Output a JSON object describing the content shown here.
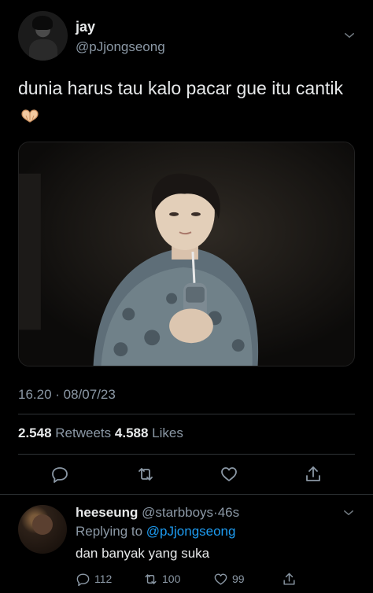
{
  "tweet": {
    "display_name": "jay",
    "handle": "@pJjongseong",
    "text": "dunia harus tau kalo pacar gue itu cantik",
    "emoji": "heart-hands-emoji",
    "timestamp": "16.20 · 08/07/23",
    "retweets_count": "2.548",
    "retweets_label": "Retweets",
    "likes_count": "4.588",
    "likes_label": "Likes"
  },
  "reply": {
    "display_name": "heeseung",
    "handle_time": "@starbboys·46s",
    "replying_prefix": "Replying to",
    "replying_to": "@pJjongseong",
    "text": "dan banyak yang suka",
    "reply_count": "112",
    "retweet_count": "100",
    "like_count": "99"
  },
  "icons": [
    "caret-down-icon",
    "reply-icon",
    "retweet-icon",
    "like-icon",
    "share-icon"
  ],
  "colors": {
    "background": "#000000",
    "text": "#e7e9ea",
    "secondary": "#8b98a5",
    "link": "#1d9bf0",
    "divider": "#2f3336"
  }
}
